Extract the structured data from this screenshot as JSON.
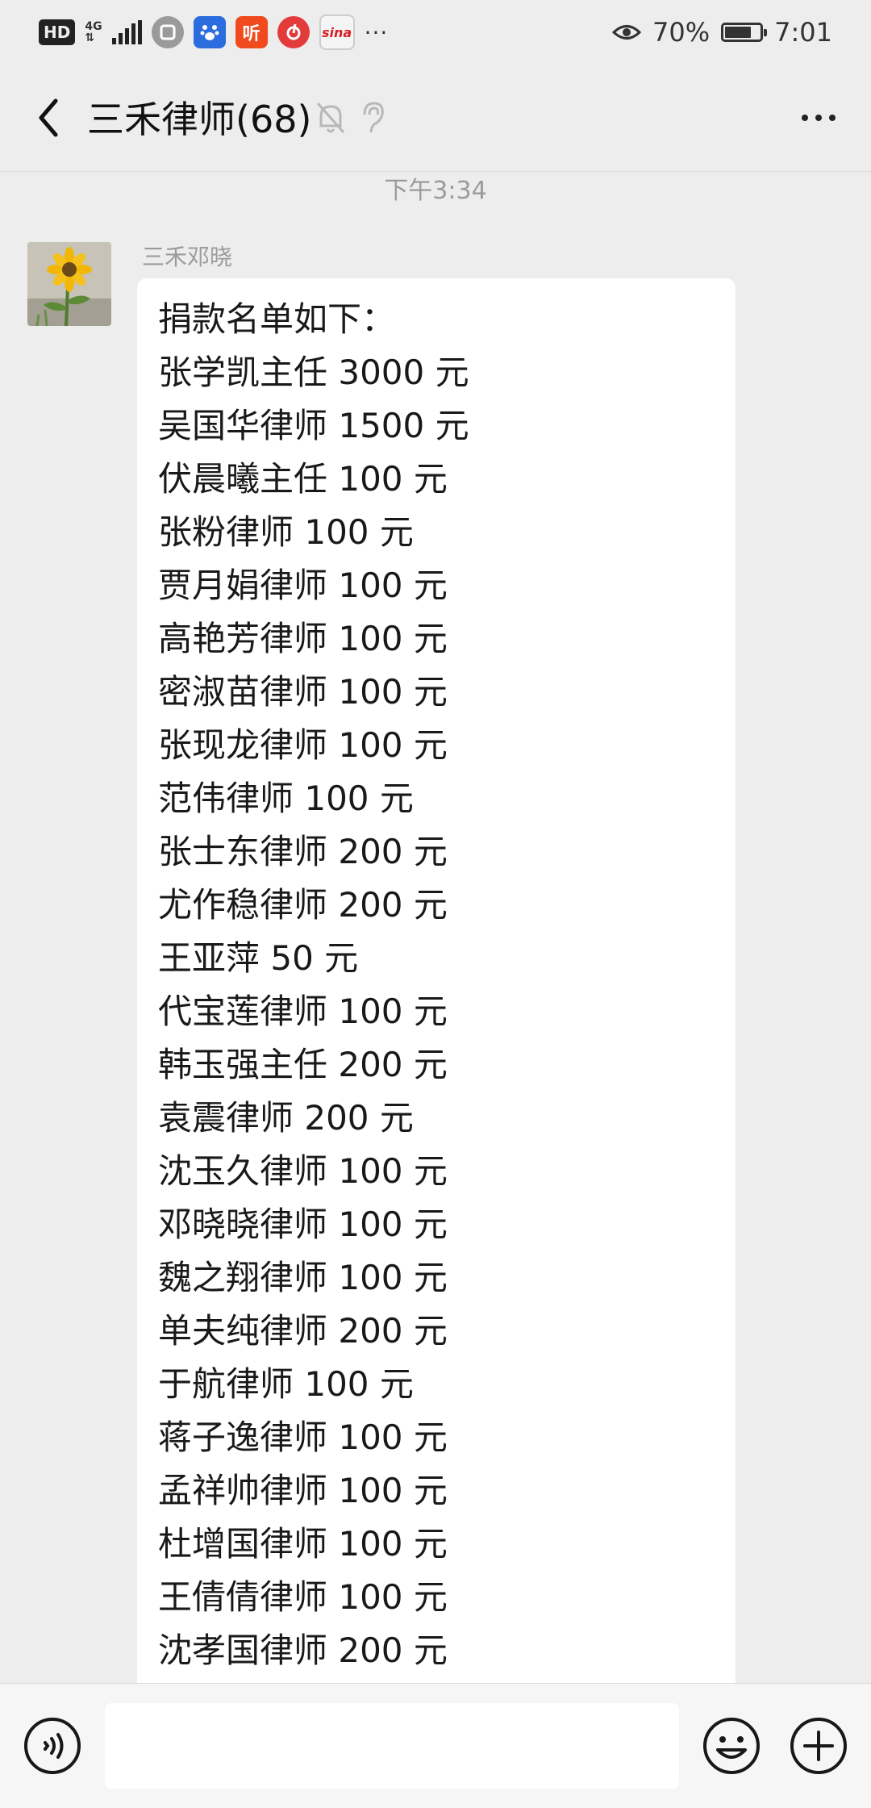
{
  "status_bar": {
    "hd_badge": "HD",
    "network": "4G",
    "icons": [
      "hd-icon",
      "signal-icon",
      "app-icon",
      "baidu-icon",
      "ting-icon",
      "netease-music-icon",
      "sina-icon"
    ],
    "more": "···",
    "battery_percent": "70%",
    "battery_level": 0.7,
    "time": "7:01"
  },
  "header": {
    "title": "三禾律师(68)",
    "icons": [
      "back-icon",
      "mute-bell-icon",
      "ear-icon",
      "more-icon"
    ]
  },
  "chat": {
    "timestamp": "下午3:34",
    "messages": [
      {
        "sender": "三禾邓晓",
        "avatar": "sunflower-avatar",
        "lines": [
          "捐款名单如下：",
          "张学凯主任 3000 元",
          "吴国华律师 1500 元",
          "伏晨曦主任 100 元",
          "张粉律师 100 元",
          "贾月娟律师 100 元",
          "高艳芳律师 100 元",
          "密淑苗律师 100 元",
          "张现龙律师 100 元",
          "范伟律师 100 元",
          "张士东律师 200 元",
          "尤作稳律师 200 元",
          "王亚萍 50 元",
          "代宝莲律师 100 元",
          "韩玉强主任 200 元",
          "袁震律师 200 元",
          "沈玉久律师 100 元",
          "邓晓晓律师 100 元",
          "魏之翔律师 100 元",
          "单夫纯律师 200 元",
          "于航律师 100 元",
          "蒋子逸律师 100 元",
          "孟祥帅律师 100 元",
          "杜增国律师 100 元",
          "王倩倩律师 100 元",
          "沈孝国律师 200 元"
        ]
      }
    ]
  },
  "input_bar": {
    "value": "",
    "icons": [
      "voice-icon",
      "emoji-icon",
      "plus-icon"
    ]
  },
  "colors": {
    "background": "#ededed",
    "bubble": "#ffffff",
    "text": "#191919",
    "meta_text": "#9b9b9b"
  }
}
